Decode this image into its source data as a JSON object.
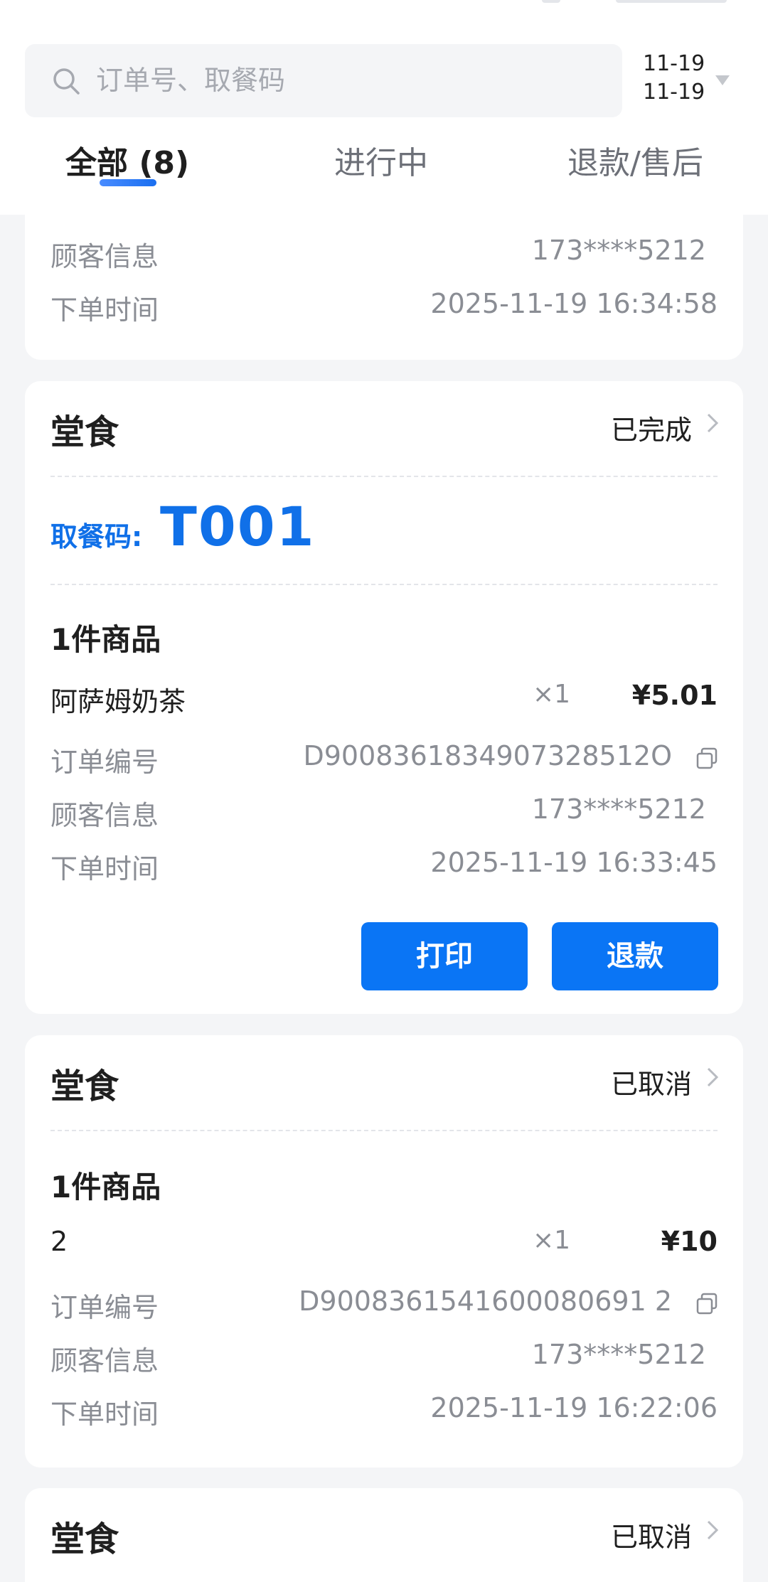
{
  "search": {
    "placeholder": "订单号、取餐码"
  },
  "date_range": {
    "start": "11-19",
    "end": "11-19"
  },
  "tabs": [
    {
      "label": "全部 (8)",
      "active": true
    },
    {
      "label": "进行中",
      "active": false
    },
    {
      "label": "退款/售后",
      "active": false
    }
  ],
  "colors": {
    "accent": "#0a75f5",
    "pickup": "#1070e8",
    "muted": "#8a8d94",
    "page_bg": "#f4f5f7"
  },
  "partial_order": {
    "customer_label": "顾客信息",
    "customer": "173****5212",
    "time_label": "下单时间",
    "time": "2025-11-19 16:34:58"
  },
  "orders": [
    {
      "type": "堂食",
      "status": "已完成",
      "pickup_label": "取餐码:",
      "pickup_code": "T001",
      "count_label": "1件商品",
      "item": {
        "name": "阿萨姆奶茶",
        "qty": "×1",
        "price": "¥5.01"
      },
      "order_no_label": "订单编号",
      "order_no": "D9008361834907328512O",
      "customer_label": "顾客信息",
      "customer": "173****5212",
      "time_label": "下单时间",
      "time": "2025-11-19 16:33:45",
      "buttons": {
        "print": "打印",
        "refund": "退款"
      }
    },
    {
      "type": "堂食",
      "status": "已取消",
      "count_label": "1件商品",
      "item": {
        "name": "2",
        "qty": "×1",
        "price": "¥10"
      },
      "order_no_label": "订单编号",
      "order_no": "D9008361541600080691 2",
      "customer_label": "顾客信息",
      "customer": "173****5212",
      "time_label": "下单时间",
      "time": "2025-11-19 16:22:06"
    },
    {
      "type": "堂食",
      "status": "已取消"
    }
  ]
}
